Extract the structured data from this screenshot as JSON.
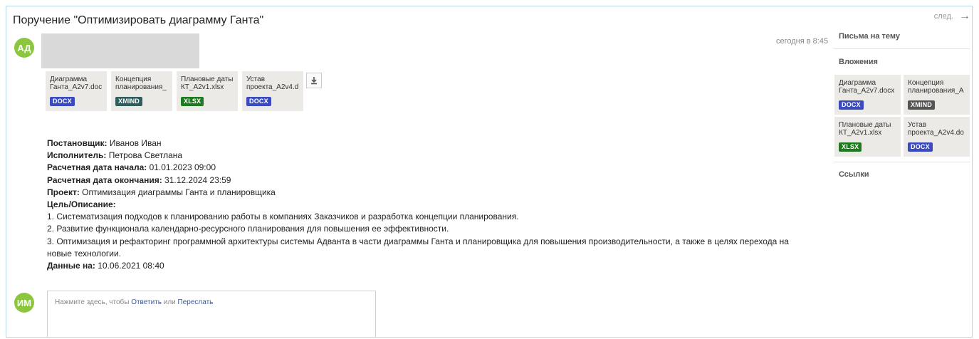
{
  "header": {
    "title": "Поручение \"Оптимизировать диаграмму Ганта\"",
    "next_label": "след.",
    "next_arrow": "→"
  },
  "message": {
    "sender_avatar": "АД",
    "timestamp": "сегодня в 8:45",
    "attachments": [
      {
        "name": "Диаграмма\nГанта_A2v7.doc",
        "type": "DOCX",
        "color": "#3b4bbf"
      },
      {
        "name": "Концепция\nпланирования_",
        "type": "XMIND",
        "color": "#2f5d5d"
      },
      {
        "name": "Плановые даты\nКТ_A2v1.xlsx",
        "type": "XLSX",
        "color": "#1e7a1e"
      },
      {
        "name": "Устав\nпроекта_A2v4.d",
        "type": "DOCX",
        "color": "#3b4bbf"
      }
    ],
    "download_icon": "download-icon",
    "fields": [
      {
        "label": "Постановщик:",
        "value": " Иванов Иван"
      },
      {
        "label": "Исполнитель:",
        "value": " Петрова Светлана"
      },
      {
        "label": "Расчетная дата начала:",
        "value": " 01.01.2023 09:00"
      },
      {
        "label": "Расчетная дата окончания:",
        "value": " 31.12.2024 23:59"
      },
      {
        "label": "Проект:",
        "value": " Оптимизация диаграммы Ганта и планировщика"
      },
      {
        "label": "Цель/Описание:",
        "value": ""
      }
    ],
    "description_lines": [
      "1. Систематизация подходов к планированию работы в компаниях Заказчиков и разработка концепции планирования.",
      "2. Развитие функционала календарно-ресурсного планирования для повышения ее эффективности.",
      "3. Оптимизация и рефакторинг программной архитектуры системы Адванта в части диаграммы Ганта и планировщика для повышения производительности, а также в целях перехода на новые технологии."
    ],
    "data_label": "Данные на:",
    "data_value": " 10.06.2021 08:40"
  },
  "reply": {
    "avatar": "ИМ",
    "prompt": "Нажмите здесь, чтобы ",
    "reply_link": "Ответить",
    "or": " или ",
    "forward_link": "Переслать"
  },
  "sidebar": {
    "threads_title": "Письма на тему",
    "attachments_title": "Вложения",
    "links_title": "Ссылки",
    "attachments": [
      {
        "name": "Диаграмма\nГанта_A2v7.docx",
        "type": "DOCX",
        "color": "#3b4bbf"
      },
      {
        "name": "Концепция\nпланирования_A",
        "type": "XMIND",
        "color": "#555555"
      },
      {
        "name": "Плановые даты\nКТ_A2v1.xlsx",
        "type": "XLSX",
        "color": "#1e7a1e"
      },
      {
        "name": "Устав\nпроекта_A2v4.do",
        "type": "DOCX",
        "color": "#3b4bbf"
      }
    ]
  }
}
